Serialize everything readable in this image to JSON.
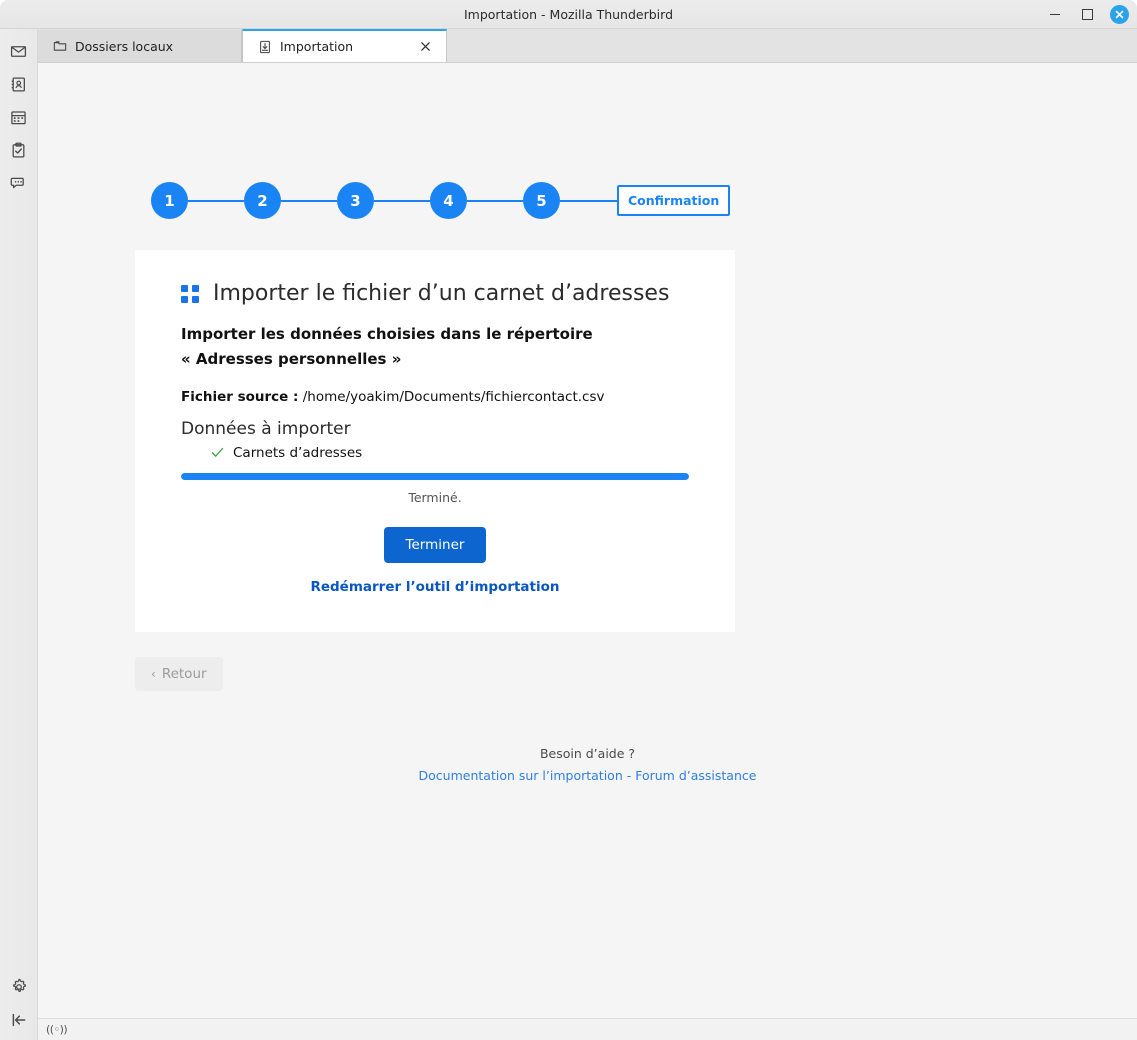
{
  "window": {
    "title": "Importation - Mozilla Thunderbird",
    "controls": {
      "minimize": "minimize-button",
      "maximize": "maximize-button",
      "close": "close-button"
    }
  },
  "sidebar": {
    "items": [
      {
        "name": "mail-icon",
        "label": "Courrier"
      },
      {
        "name": "address-book-icon",
        "label": "Carnet d’adresses"
      },
      {
        "name": "calendar-icon",
        "label": "Agenda"
      },
      {
        "name": "tasks-icon",
        "label": "Tâches"
      },
      {
        "name": "chat-icon",
        "label": "Messagerie instantanée"
      }
    ],
    "footer": [
      {
        "name": "settings-gear-icon",
        "label": "Paramètres"
      },
      {
        "name": "collapse-panel-icon",
        "label": "Réduire le volet"
      }
    ]
  },
  "tabs": [
    {
      "label": "Dossiers locaux",
      "icon": "folder-icon",
      "active": false,
      "closable": false
    },
    {
      "label": "Importation",
      "icon": "import-icon",
      "active": true,
      "closable": true
    }
  ],
  "stepper": {
    "steps": [
      "1",
      "2",
      "3",
      "4",
      "5"
    ],
    "final_label": "Confirmation",
    "accent_color": "#1a84f5"
  },
  "card": {
    "icon": "address-book-grid-icon",
    "title": "Importer le fichier d’un carnet d’adresses",
    "subtitle": "Importer les données choisies dans le répertoire « Adresses personnelles »",
    "source_label": "Fichier source :",
    "source_path": "/home/yoakim/Documents/fichiercontact.csv",
    "data_section_title": "Données à importer",
    "items": [
      {
        "label": "Carnets d’adresses",
        "state": "done",
        "check": "✓"
      }
    ],
    "progress_percent": 100,
    "status_text": "Terminé.",
    "primary_button": "Terminer",
    "restart_link": "Redémarrer l’outil d’importation"
  },
  "navigation": {
    "back_label": "Retour",
    "back_chevron": "‹",
    "back_disabled": true
  },
  "footer": {
    "need_help": "Besoin d’aide ?",
    "doc_link": "Documentation sur l’importation",
    "separator": " - ",
    "forum_link": "Forum d’assistance"
  },
  "statusbar": {
    "connection_glyph": "((◦))"
  }
}
